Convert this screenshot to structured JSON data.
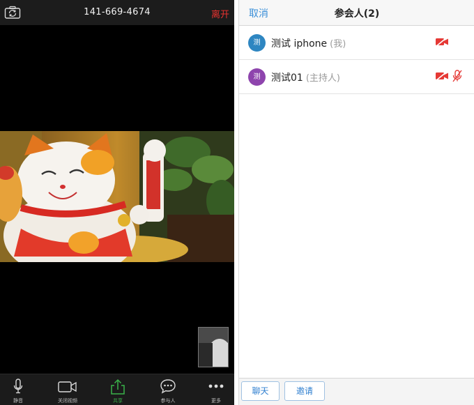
{
  "meeting": {
    "meeting_id": "141-669-4674",
    "leave_label": "离开",
    "toolbar": [
      {
        "label": "静音",
        "icon": "microphone-icon"
      },
      {
        "label": "关闭视频",
        "icon": "video-camera-icon"
      },
      {
        "label": "共享",
        "icon": "share-icon"
      },
      {
        "label": "参与人",
        "icon": "participants-icon"
      },
      {
        "label": "更多",
        "icon": "more-icon"
      }
    ]
  },
  "participants_panel": {
    "cancel_label": "取消",
    "title": "参会人(2)",
    "list": [
      {
        "avatar_text": "测",
        "name": "测试 iphone",
        "tag": "(我)",
        "avatar_color": "#2e86c1"
      },
      {
        "avatar_text": "测",
        "name": "测试01",
        "tag": "(主持人)",
        "avatar_color": "#8e44ad"
      }
    ],
    "chat_label": "聊天",
    "invite_label": "邀请"
  },
  "colors": {
    "accent_blue": "#3a8fd8",
    "leave_red": "#e8322f",
    "share_green": "#3bb34a",
    "muted_red": "#e53935"
  }
}
